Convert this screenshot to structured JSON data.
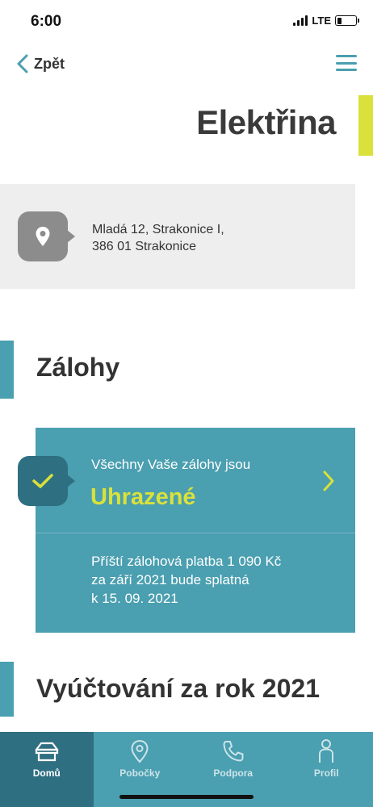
{
  "status_bar": {
    "time": "6:00",
    "network": "LTE"
  },
  "nav": {
    "back_label": "Zpět",
    "back_icon": "chevron-left-icon",
    "menu_icon": "hamburger-icon"
  },
  "page": {
    "title": "Elektřina"
  },
  "address": {
    "line1": "Mladá 12, Strakonice I,",
    "line2": "386 01 Strakonice",
    "icon": "location-pin-icon"
  },
  "payments": {
    "heading": "Zálohy",
    "intro": "Všechny Vaše zálohy jsou",
    "status": "Uhrazené",
    "next_line1": "Příští zálohová platba 1 090 Kč",
    "next_line2": "za září 2021 bude splatná",
    "next_line3": "k 15. 09. 2021"
  },
  "billing": {
    "heading": "Vyúčtování za rok 2021"
  },
  "tabs": [
    {
      "label": "Domů",
      "icon": "home-icon",
      "active": true
    },
    {
      "label": "Pobočky",
      "icon": "location-pin-icon",
      "active": false
    },
    {
      "label": "Podpora",
      "icon": "phone-icon",
      "active": false
    },
    {
      "label": "Profil",
      "icon": "person-icon",
      "active": false
    }
  ],
  "colors": {
    "accent_teal": "#4a9fb0",
    "dark_teal": "#2f6f82",
    "accent_yellow": "#d9e13a",
    "card_gray": "#eeeeee",
    "icon_gray": "#8c8c8c",
    "text_dark": "#333333"
  }
}
